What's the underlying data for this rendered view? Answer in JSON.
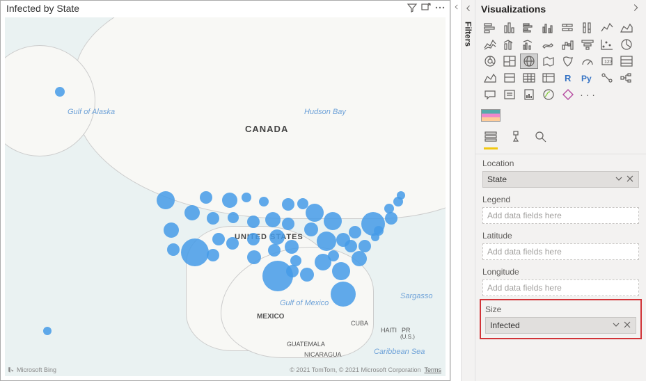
{
  "visual": {
    "title": "Infected by State",
    "map": {
      "water": {
        "gulf_of_alaska": "Gulf of Alaska",
        "hudson_bay": "Hudson Bay",
        "gulf_of_mexico": "Gulf of Mexico",
        "sargasso": "Sargasso",
        "caribbean_sea": "Caribbean Sea"
      },
      "countries": {
        "canada": "CANADA",
        "united_states": "UNITED STATES",
        "mexico": "MEXICO",
        "guatemala": "GUATEMALA",
        "nicaragua": "NICARAGUA",
        "cuba": "CUBA",
        "haiti": "HAITI",
        "pr": "PR",
        "pr_sub": "(U.S.)"
      }
    },
    "footer": {
      "bing": "Microsoft Bing",
      "copyright": "© 2021 TomTom, © 2021 Microsoft Corporation",
      "terms": "Terms"
    }
  },
  "filters": {
    "label": "Filters"
  },
  "viz": {
    "title": "Visualizations",
    "placeholder": "Add data fields here",
    "location": {
      "label": "Location",
      "value": "State"
    },
    "legend": {
      "label": "Legend"
    },
    "latitude": {
      "label": "Latitude"
    },
    "longitude": {
      "label": "Longitude"
    },
    "size": {
      "label": "Size",
      "value": "Infected"
    },
    "gallery_more": "· · ·"
  }
}
